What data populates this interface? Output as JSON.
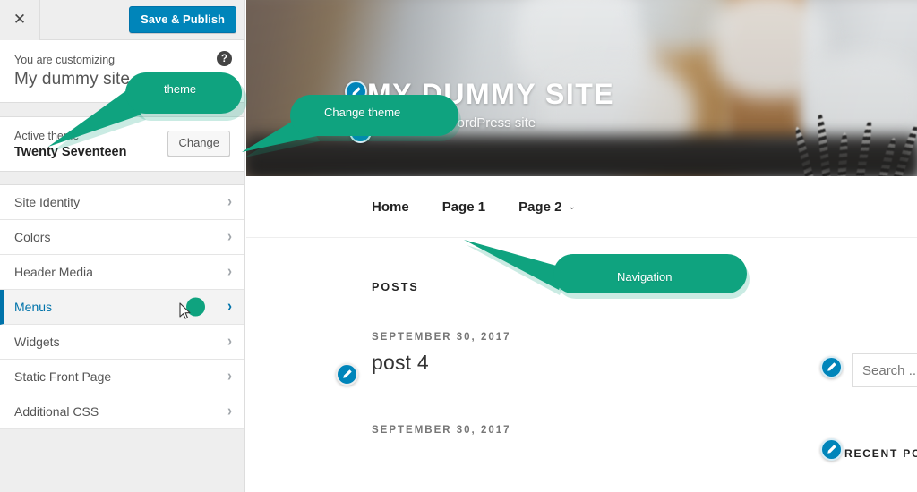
{
  "sidebar": {
    "close_label": "✕",
    "save_label": "Save & Publish",
    "help_label": "?",
    "customizing_label": "You are customizing",
    "site_name": "My dummy site",
    "active_theme_label": "Active theme",
    "active_theme_name": "Twenty Seventeen",
    "change_label": "Change",
    "items": [
      {
        "label": "Site Identity",
        "chevron": "›",
        "active": false
      },
      {
        "label": "Colors",
        "chevron": "›",
        "active": false
      },
      {
        "label": "Header Media",
        "chevron": "›",
        "active": false
      },
      {
        "label": "Menus",
        "chevron": "›",
        "active": true
      },
      {
        "label": "Widgets",
        "chevron": "›",
        "active": false
      },
      {
        "label": "Static Front Page",
        "chevron": "›",
        "active": false
      },
      {
        "label": "Additional CSS",
        "chevron": "›",
        "active": false
      }
    ]
  },
  "preview": {
    "site_title": "MY DUMMY SITE",
    "tagline": "Just another WordPress site",
    "nav": [
      {
        "label": "Home",
        "caret": ""
      },
      {
        "label": "Page 1",
        "caret": ""
      },
      {
        "label": "Page 2",
        "caret": "⌄"
      }
    ],
    "posts_heading": "POSTS",
    "posts": [
      {
        "date": "SEPTEMBER 30, 2017",
        "title": "post 4"
      },
      {
        "date": "SEPTEMBER 30, 2017",
        "title": ""
      }
    ],
    "search_placeholder": "Search ...",
    "recent_posts_heading": "RECENT POS"
  },
  "callouts": [
    {
      "label": "theme"
    },
    {
      "label": "Change theme"
    },
    {
      "label": "Navigation"
    }
  ],
  "colors": {
    "accent_blue": "#0085ba",
    "callout_green": "#0fa37f",
    "sidebar_bg": "#eeeeee",
    "active_item": "#0073aa"
  }
}
